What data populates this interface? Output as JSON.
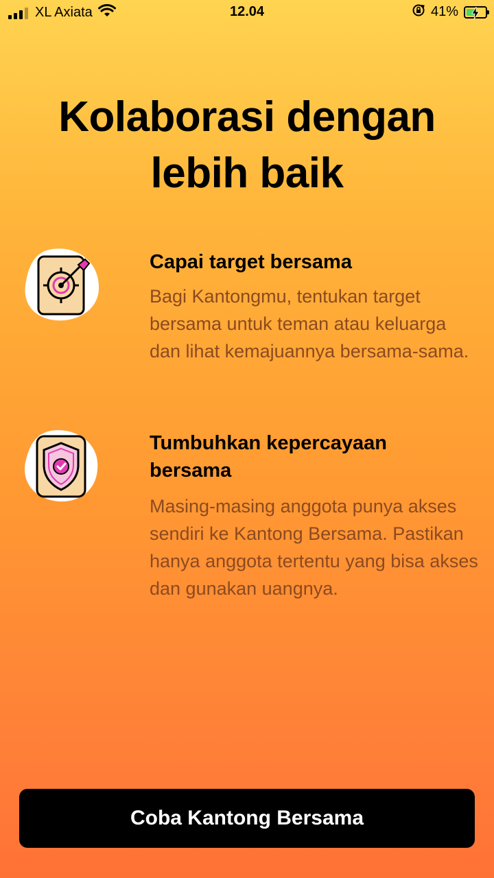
{
  "status_bar": {
    "carrier": "XL Axiata",
    "time": "12.04",
    "battery_percent": "41%",
    "battery_level": 0.41,
    "signal_bars_active": 3,
    "icons": [
      "signal-icon",
      "wifi-icon",
      "rotation-lock-icon",
      "battery-charging-icon"
    ]
  },
  "title": "Kolaborasi dengan lebih baik",
  "features": [
    {
      "icon": "target-icon",
      "title": "Capai target bersama",
      "description": "Bagi Kantongmu, tentukan target bersama untuk teman atau keluarga dan lihat kemajuannya bersama-sama."
    },
    {
      "icon": "shield-check-icon",
      "title": "Tumbuhkan kepercayaan bersama",
      "description": "Masing-masing anggota punya akses sendiri ke Kantong Bersama. Pastikan hanya anggota tertentu yang bisa akses dan gunakan uangnya."
    }
  ],
  "cta_label": "Coba Kantong Bersama",
  "colors": {
    "background_top": "#FFD450",
    "background_bottom": "#FF7236",
    "description_text": "#8C4A20",
    "button": "#000000",
    "icon_accent": "#E23BB0"
  }
}
